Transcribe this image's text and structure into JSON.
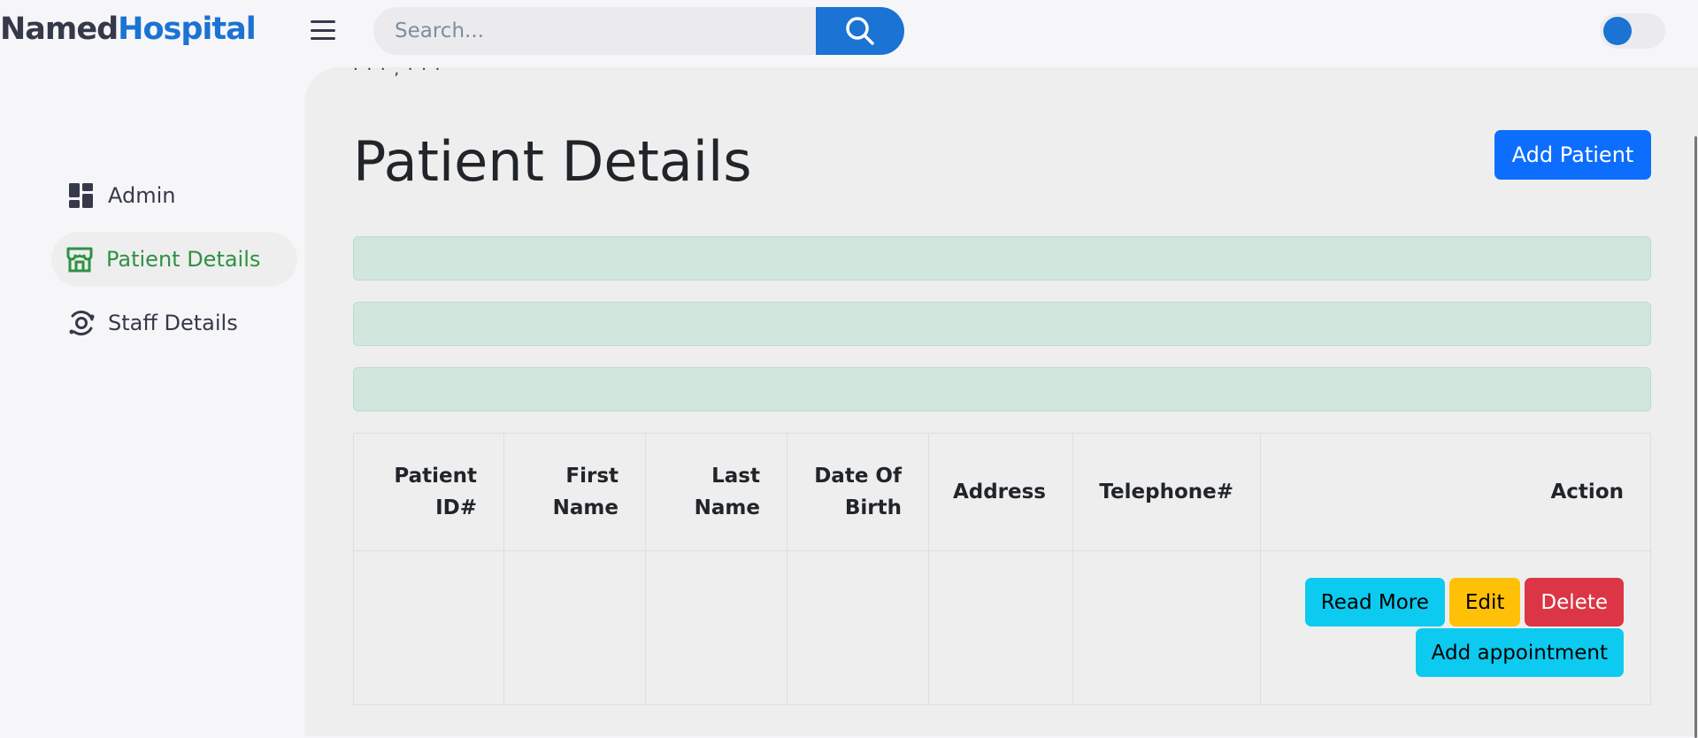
{
  "brand": {
    "part1": "Named",
    "part2": "Hospital"
  },
  "search": {
    "placeholder": "Search..."
  },
  "sidebar": {
    "items": [
      {
        "label": "Admin",
        "icon": "dashboard-icon"
      },
      {
        "label": "Patient Details",
        "icon": "storefront-icon",
        "active": true
      },
      {
        "label": "Staff Details",
        "icon": "orbit-icon"
      }
    ]
  },
  "breadcrumb_fragment": "· · · , · · ·",
  "main": {
    "title": "Patient Details",
    "add_button": "Add Patient"
  },
  "table": {
    "headers": [
      [
        "Patient",
        "ID#"
      ],
      [
        "First",
        "Name"
      ],
      [
        "Last",
        "Name"
      ],
      [
        "Date Of",
        "Birth"
      ],
      [
        "Address"
      ],
      [
        "Telephone#"
      ],
      [
        "Action"
      ]
    ],
    "row_actions": {
      "read_more": "Read More",
      "edit": "Edit",
      "delete": "Delete",
      "add_appointment": "Add appointment"
    }
  },
  "colors": {
    "accent": "#1b73d3",
    "active_green": "#2e9142",
    "alert_bg": "#d1e7dd",
    "primary": "#0d6efd",
    "info": "#0dcaf0",
    "warning": "#ffc107",
    "danger": "#dc3545"
  }
}
